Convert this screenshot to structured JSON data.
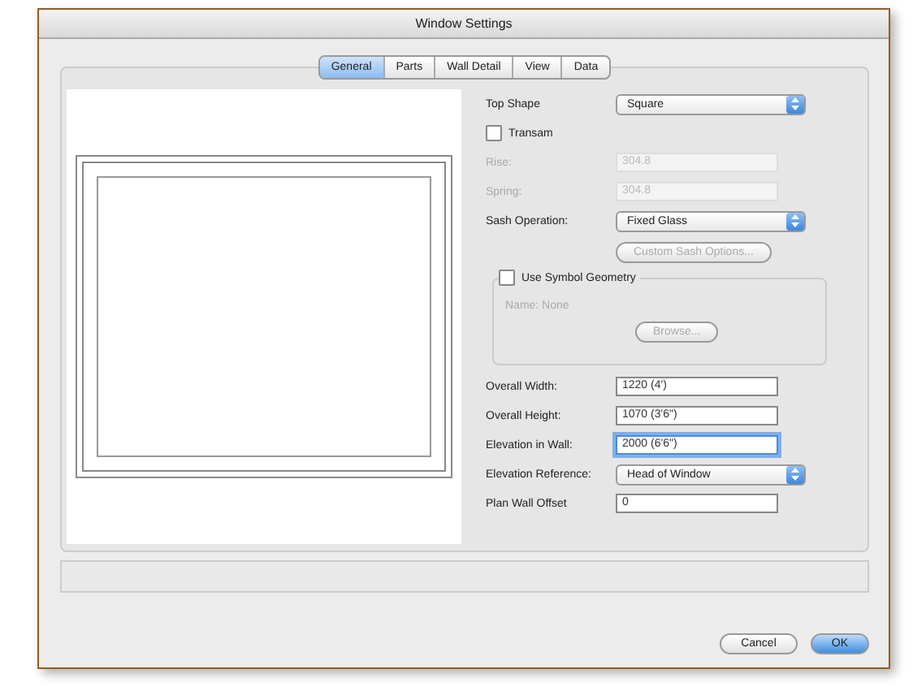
{
  "window": {
    "title": "Window Settings"
  },
  "tabs": [
    {
      "label": "General",
      "selected": true
    },
    {
      "label": "Parts",
      "selected": false
    },
    {
      "label": "Wall Detail",
      "selected": false
    },
    {
      "label": "View",
      "selected": false
    },
    {
      "label": "Data",
      "selected": false
    }
  ],
  "form": [
    {
      "kind": "popup",
      "label": "Top Shape",
      "value": "Square"
    },
    {
      "kind": "checkbox",
      "label": "Transam",
      "checked": false
    },
    {
      "kind": "field",
      "label": "Rise:",
      "value": "304.8",
      "disabled": true,
      "focused": false
    },
    {
      "kind": "field",
      "label": "Spring:",
      "value": "304.8",
      "disabled": true,
      "focused": false
    },
    {
      "kind": "popup",
      "label": "Sash Operation:",
      "value": "Fixed Glass"
    },
    {
      "kind": "button",
      "label": "Custom Sash Options...",
      "disabled": true
    },
    {
      "kind": "group",
      "label": "Use Symbol Geometry",
      "checked": false,
      "text": "Name: None",
      "button": "Browse...",
      "disabled": true
    },
    {
      "kind": "field",
      "label": "Overall Width:",
      "value": "1220 (4')",
      "disabled": false,
      "focused": false
    },
    {
      "kind": "field",
      "label": "Overall Height:",
      "value": "1070 (3'6\")",
      "disabled": false,
      "focused": false
    },
    {
      "kind": "field",
      "label": "Elevation in Wall:",
      "value": "2000 (6'6\")",
      "disabled": false,
      "focused": true
    },
    {
      "kind": "popup",
      "label": "Elevation Reference:",
      "value": "Head of Window"
    },
    {
      "kind": "field",
      "label": "Plan Wall Offset",
      "value": "0",
      "disabled": false,
      "focused": false
    }
  ],
  "buttons": [
    {
      "label": "Cancel",
      "default": false
    },
    {
      "label": "OK",
      "default": true
    }
  ]
}
